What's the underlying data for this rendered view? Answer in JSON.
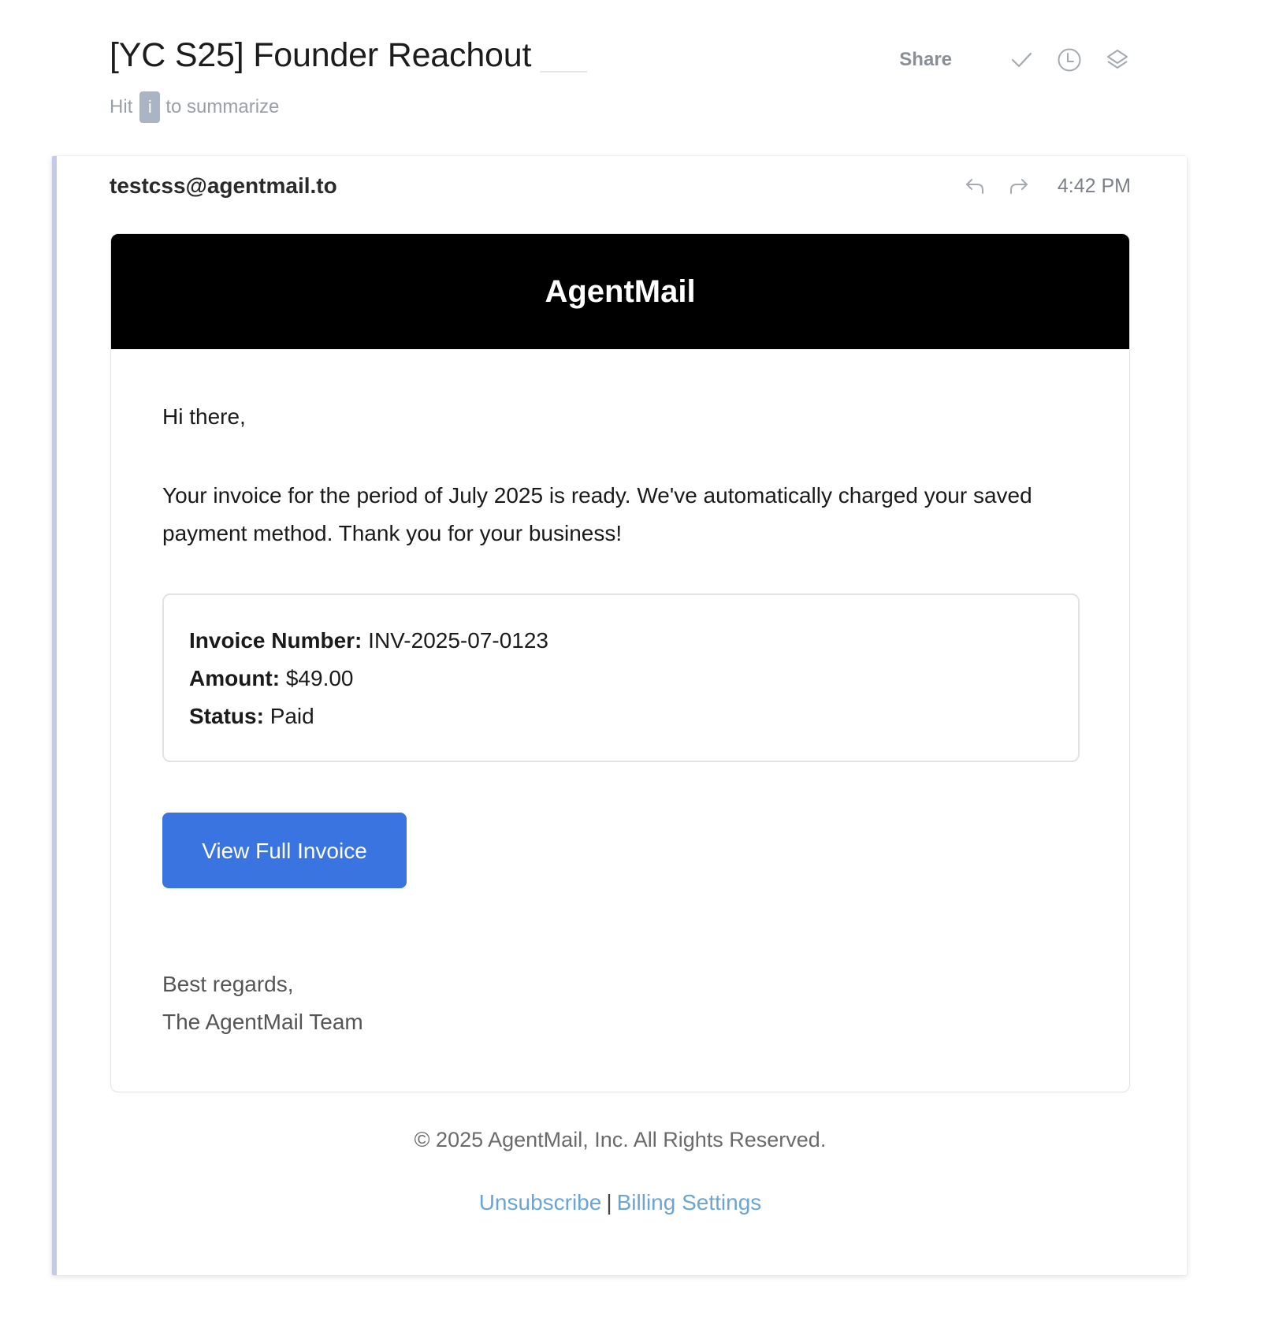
{
  "thread": {
    "title": "[YC S25] Founder Reachout",
    "hint_prefix": "Hit",
    "hint_key": "i",
    "hint_suffix": "to summarize"
  },
  "header_actions": {
    "share_label": "Share",
    "icons": [
      "check-icon",
      "clock-icon",
      "layers-icon"
    ]
  },
  "message": {
    "sender": "testcss@agentmail.to",
    "time": "4:42 PM",
    "icons": [
      "reply-icon",
      "forward-icon"
    ]
  },
  "email": {
    "brand": "AgentMail",
    "greeting": "Hi there,",
    "intro": "Your invoice for the period of July 2025 is ready. We've automatically charged your saved payment method. Thank you for your business!",
    "invoice": {
      "number_label": "Invoice Number:",
      "number_value": "INV-2025-07-0123",
      "amount_label": "Amount:",
      "amount_value": "$49.00",
      "status_label": "Status:",
      "status_value": "Paid"
    },
    "button_label": "View Full Invoice",
    "signoff_line1": "Best regards,",
    "signoff_line2": "The AgentMail Team"
  },
  "footer": {
    "copyright": "© 2025 AgentMail, Inc. All Rights Reserved.",
    "unsubscribe": "Unsubscribe",
    "separator": "|",
    "billing_settings": "Billing Settings"
  },
  "colors": {
    "accent_button": "#3a74e0",
    "link": "#6aa5d6",
    "brand_banner": "#000000",
    "thread_rail": "#c5cae8"
  }
}
